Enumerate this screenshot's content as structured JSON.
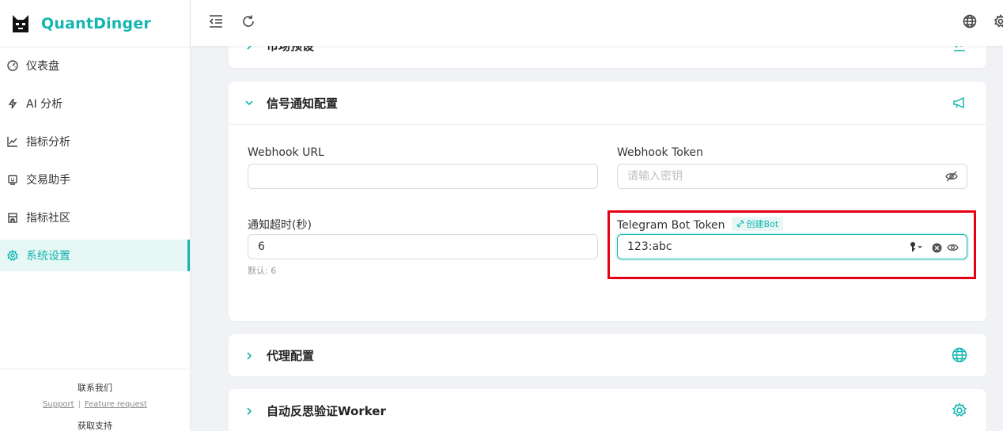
{
  "app": {
    "name": "QuantDinger"
  },
  "sidebar": {
    "items": [
      {
        "label": "仪表盘",
        "icon": "dashboard-icon"
      },
      {
        "label": "AI 分析",
        "icon": "lightning-icon"
      },
      {
        "label": "指标分析",
        "icon": "line-chart-icon"
      },
      {
        "label": "交易助手",
        "icon": "robot-icon"
      },
      {
        "label": "指标社区",
        "icon": "shop-icon"
      },
      {
        "label": "系统设置",
        "icon": "gear-icon",
        "active": true
      }
    ],
    "footer": {
      "contact": "联系我们",
      "support_link": "Support",
      "separator": "|",
      "feature_link": "Feature request",
      "get_support": "获取支持"
    }
  },
  "header": {
    "icons": [
      "menu-fold-icon",
      "refresh-icon",
      "globe-icon",
      "gear-icon"
    ]
  },
  "sections": {
    "market_preset": {
      "title": "市场预设"
    },
    "signal": {
      "title": "信号通知配置",
      "webhook_url": {
        "label": "Webhook URL",
        "value": ""
      },
      "webhook_token": {
        "label": "Webhook Token",
        "placeholder": "请输入密钥",
        "value": ""
      },
      "timeout": {
        "label": "通知超时(秒)",
        "value": "6",
        "hint": "默认: 6"
      },
      "telegram": {
        "label": "Telegram Bot Token",
        "tag": "创建Bot",
        "value": "123:abc"
      }
    },
    "proxy": {
      "title": "代理配置"
    },
    "worker": {
      "title": "自动反思验证Worker"
    }
  },
  "colors": {
    "accent": "#13b5b1",
    "highlight": "#e60012"
  }
}
